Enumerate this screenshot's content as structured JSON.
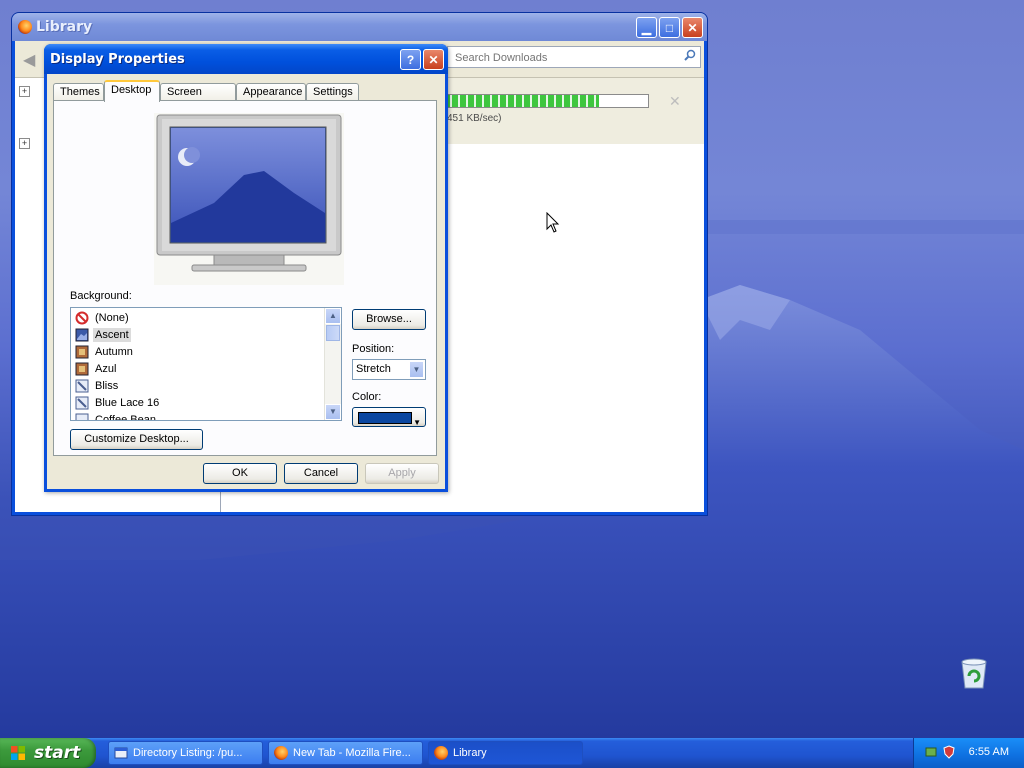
{
  "library": {
    "title": "Library",
    "search_placeholder": "Search Downloads",
    "download_speed": "451 KB/sec)",
    "download_progress": 0.76
  },
  "display_properties": {
    "title": "Display Properties",
    "help_label": "?",
    "tabs": [
      {
        "label": "Themes"
      },
      {
        "label": "Desktop"
      },
      {
        "label": "Screen Saver"
      },
      {
        "label": "Appearance"
      },
      {
        "label": "Settings"
      }
    ],
    "active_tab": "Desktop",
    "background_label": "Background:",
    "backgrounds": [
      {
        "label": "(None)",
        "icon": "no-symbol-icon"
      },
      {
        "label": "Ascent",
        "icon": "image-file-icon"
      },
      {
        "label": "Autumn",
        "icon": "image-file-icon"
      },
      {
        "label": "Azul",
        "icon": "image-file-icon"
      },
      {
        "label": "Bliss",
        "icon": "image-file-icon"
      },
      {
        "label": "Blue Lace 16",
        "icon": "image-file-icon"
      },
      {
        "label": "Coffee Bean",
        "icon": "image-file-icon"
      }
    ],
    "selected_background": "Ascent",
    "browse_label": "Browse...",
    "position_label": "Position:",
    "position_value": "Stretch",
    "color_label": "Color:",
    "color_value": "#0a46a0",
    "customize_label": "Customize Desktop...",
    "ok_label": "OK",
    "cancel_label": "Cancel",
    "apply_label": "Apply"
  },
  "taskbar": {
    "start_label": "start",
    "tasks": [
      {
        "label": "Directory Listing: /pu..."
      },
      {
        "label": "New Tab - Mozilla Fire..."
      },
      {
        "label": "Library"
      }
    ],
    "clock": "6:55 AM"
  },
  "colors": {
    "xp_blue": "#0050dc",
    "taskbar": "#245edb",
    "start_green": "#3c9a3c",
    "progress_green": "#3fc63f"
  }
}
